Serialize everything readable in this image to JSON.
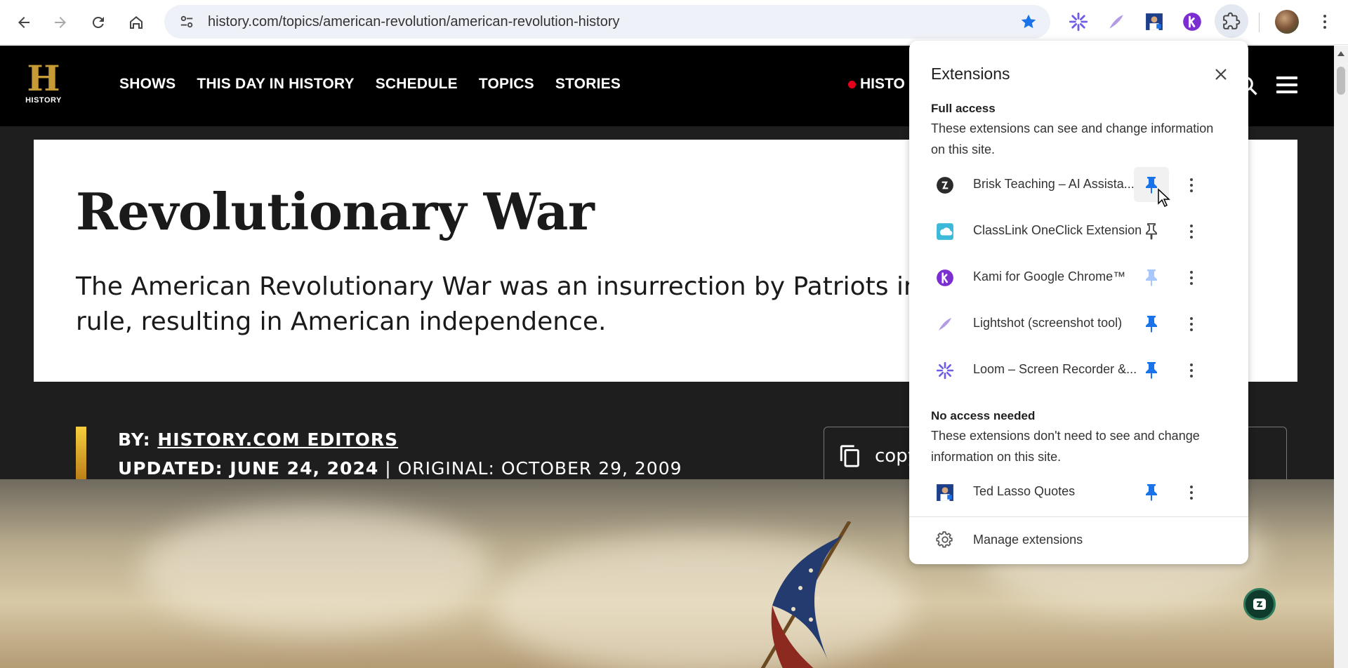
{
  "browser": {
    "url": "history.com/topics/american-revolution/american-revolution-history",
    "toolbar_extensions": [
      "loom-icon",
      "lightshot-icon",
      "ted-lasso-icon",
      "kami-icon"
    ]
  },
  "site": {
    "logo_text": "HISTORY",
    "nav": [
      "SHOWS",
      "THIS DAY IN HISTORY",
      "SCHEDULE",
      "TOPICS",
      "STORIES"
    ],
    "live_label": "HISTO",
    "title": "Revolutionary War",
    "subtitle": "The American Revolutionary War was an insurrection by Patriots in the  rule, resulting in American independence.",
    "subtitle_line1": "The American Revolutionary War was an insurrection by Patriots in the",
    "subtitle_line2": "rule, resulting in American independence.",
    "byline_prefix": "BY: ",
    "byline_author": "HISTORY.COM EDITORS",
    "updated_label": "UPDATED: JUNE 24, 2024",
    "separator": " | ",
    "original_label": "ORIGINAL: OCTOBER 29, 2009",
    "copy_label": "copy p"
  },
  "extensions_popup": {
    "title": "Extensions",
    "full_access": {
      "title": "Full access",
      "description": "These extensions can see and change information on this site.",
      "items": [
        {
          "name": "Brisk Teaching – AI Assista...",
          "pinned": true
        },
        {
          "name": "ClassLink OneClick Extension",
          "pinned": false
        },
        {
          "name": "Kami for Google Chrome™",
          "pinned": true
        },
        {
          "name": "Lightshot (screenshot tool)",
          "pinned": true
        },
        {
          "name": "Loom – Screen Recorder &...",
          "pinned": true
        }
      ]
    },
    "no_access": {
      "title": "No access needed",
      "description": "These extensions don't need to see and change information on this site.",
      "items": [
        {
          "name": "Ted Lasso Quotes",
          "pinned": true
        }
      ]
    },
    "manage_label": "Manage extensions"
  },
  "colors": {
    "pin_blue": "#1a73e8",
    "pin_light": "#a8c7fa",
    "history_gold": "#c69a34",
    "live_red": "#e4001b"
  }
}
